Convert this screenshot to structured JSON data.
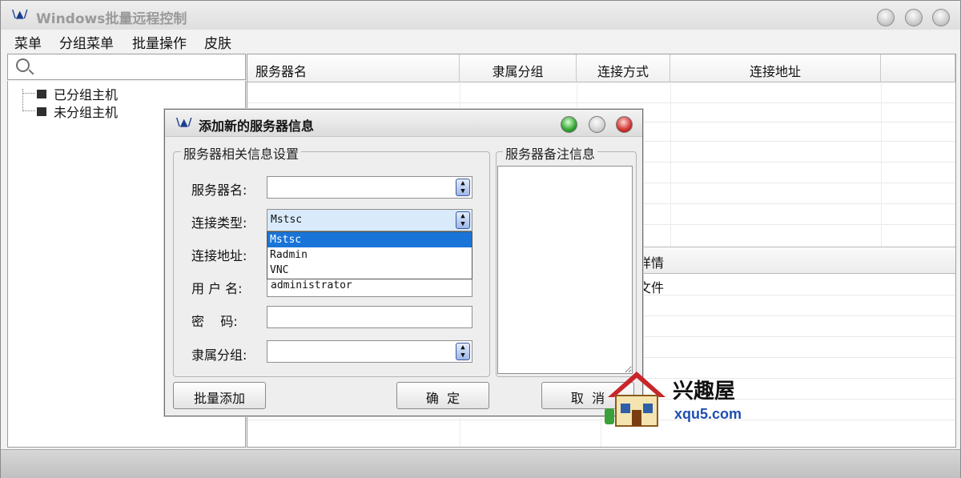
{
  "app": {
    "title": "Windows批量远程控制"
  },
  "menu": {
    "items": [
      "菜单",
      "分组菜单",
      "批量操作",
      "皮肤"
    ]
  },
  "search": {
    "placeholder": ""
  },
  "tree": {
    "items": [
      "已分组主机",
      "未分组主机"
    ]
  },
  "table": {
    "columns": [
      "服务器名",
      "隶属分组",
      "连接方式",
      "连接地址"
    ]
  },
  "details": {
    "header_partial": "详情",
    "row_partial": "文件"
  },
  "dialog": {
    "title": "添加新的服务器信息",
    "group_main": "服务器相关信息设置",
    "group_notes": "服务器备注信息",
    "labels": {
      "server_name": "服务器名:",
      "conn_type": "连接类型:",
      "conn_addr": "连接地址:",
      "username": "用 户 名:",
      "password": "密    码:",
      "group": "隶属分组:"
    },
    "values": {
      "server_name": "",
      "conn_type": "Mstsc",
      "conn_addr": "",
      "username": "administrator",
      "password": "",
      "group": ""
    },
    "conn_type_options": [
      "Mstsc",
      "Radmin",
      "VNC"
    ],
    "buttons": {
      "batch_add": "批量添加",
      "ok": "确  定",
      "cancel": "取  消"
    }
  },
  "watermark": {
    "name": "兴趣屋",
    "url": "xqu5.com"
  },
  "colors": {
    "selection": "#1874d6",
    "dot_green": "#2fa32f",
    "dot_red": "#d0312d"
  }
}
